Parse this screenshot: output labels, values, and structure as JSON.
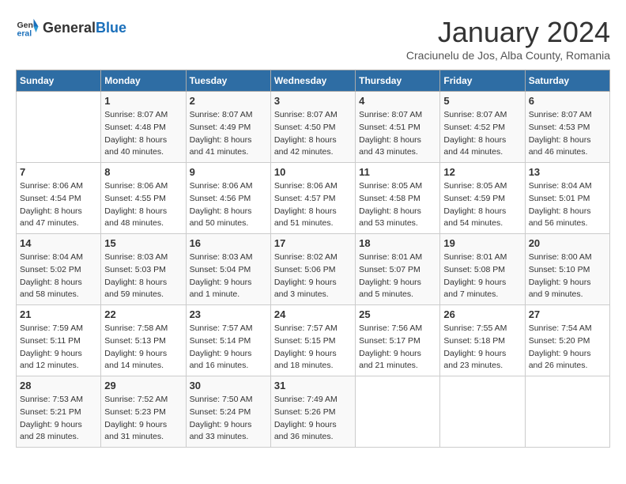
{
  "header": {
    "logo_general": "General",
    "logo_blue": "Blue",
    "month_title": "January 2024",
    "subtitle": "Craciunelu de Jos, Alba County, Romania"
  },
  "days_of_week": [
    "Sunday",
    "Monday",
    "Tuesday",
    "Wednesday",
    "Thursday",
    "Friday",
    "Saturday"
  ],
  "weeks": [
    [
      {
        "day": "",
        "info": ""
      },
      {
        "day": "1",
        "info": "Sunrise: 8:07 AM\nSunset: 4:48 PM\nDaylight: 8 hours\nand 40 minutes."
      },
      {
        "day": "2",
        "info": "Sunrise: 8:07 AM\nSunset: 4:49 PM\nDaylight: 8 hours\nand 41 minutes."
      },
      {
        "day": "3",
        "info": "Sunrise: 8:07 AM\nSunset: 4:50 PM\nDaylight: 8 hours\nand 42 minutes."
      },
      {
        "day": "4",
        "info": "Sunrise: 8:07 AM\nSunset: 4:51 PM\nDaylight: 8 hours\nand 43 minutes."
      },
      {
        "day": "5",
        "info": "Sunrise: 8:07 AM\nSunset: 4:52 PM\nDaylight: 8 hours\nand 44 minutes."
      },
      {
        "day": "6",
        "info": "Sunrise: 8:07 AM\nSunset: 4:53 PM\nDaylight: 8 hours\nand 46 minutes."
      }
    ],
    [
      {
        "day": "7",
        "info": "Sunrise: 8:06 AM\nSunset: 4:54 PM\nDaylight: 8 hours\nand 47 minutes."
      },
      {
        "day": "8",
        "info": "Sunrise: 8:06 AM\nSunset: 4:55 PM\nDaylight: 8 hours\nand 48 minutes."
      },
      {
        "day": "9",
        "info": "Sunrise: 8:06 AM\nSunset: 4:56 PM\nDaylight: 8 hours\nand 50 minutes."
      },
      {
        "day": "10",
        "info": "Sunrise: 8:06 AM\nSunset: 4:57 PM\nDaylight: 8 hours\nand 51 minutes."
      },
      {
        "day": "11",
        "info": "Sunrise: 8:05 AM\nSunset: 4:58 PM\nDaylight: 8 hours\nand 53 minutes."
      },
      {
        "day": "12",
        "info": "Sunrise: 8:05 AM\nSunset: 4:59 PM\nDaylight: 8 hours\nand 54 minutes."
      },
      {
        "day": "13",
        "info": "Sunrise: 8:04 AM\nSunset: 5:01 PM\nDaylight: 8 hours\nand 56 minutes."
      }
    ],
    [
      {
        "day": "14",
        "info": "Sunrise: 8:04 AM\nSunset: 5:02 PM\nDaylight: 8 hours\nand 58 minutes."
      },
      {
        "day": "15",
        "info": "Sunrise: 8:03 AM\nSunset: 5:03 PM\nDaylight: 8 hours\nand 59 minutes."
      },
      {
        "day": "16",
        "info": "Sunrise: 8:03 AM\nSunset: 5:04 PM\nDaylight: 9 hours\nand 1 minute."
      },
      {
        "day": "17",
        "info": "Sunrise: 8:02 AM\nSunset: 5:06 PM\nDaylight: 9 hours\nand 3 minutes."
      },
      {
        "day": "18",
        "info": "Sunrise: 8:01 AM\nSunset: 5:07 PM\nDaylight: 9 hours\nand 5 minutes."
      },
      {
        "day": "19",
        "info": "Sunrise: 8:01 AM\nSunset: 5:08 PM\nDaylight: 9 hours\nand 7 minutes."
      },
      {
        "day": "20",
        "info": "Sunrise: 8:00 AM\nSunset: 5:10 PM\nDaylight: 9 hours\nand 9 minutes."
      }
    ],
    [
      {
        "day": "21",
        "info": "Sunrise: 7:59 AM\nSunset: 5:11 PM\nDaylight: 9 hours\nand 12 minutes."
      },
      {
        "day": "22",
        "info": "Sunrise: 7:58 AM\nSunset: 5:13 PM\nDaylight: 9 hours\nand 14 minutes."
      },
      {
        "day": "23",
        "info": "Sunrise: 7:57 AM\nSunset: 5:14 PM\nDaylight: 9 hours\nand 16 minutes."
      },
      {
        "day": "24",
        "info": "Sunrise: 7:57 AM\nSunset: 5:15 PM\nDaylight: 9 hours\nand 18 minutes."
      },
      {
        "day": "25",
        "info": "Sunrise: 7:56 AM\nSunset: 5:17 PM\nDaylight: 9 hours\nand 21 minutes."
      },
      {
        "day": "26",
        "info": "Sunrise: 7:55 AM\nSunset: 5:18 PM\nDaylight: 9 hours\nand 23 minutes."
      },
      {
        "day": "27",
        "info": "Sunrise: 7:54 AM\nSunset: 5:20 PM\nDaylight: 9 hours\nand 26 minutes."
      }
    ],
    [
      {
        "day": "28",
        "info": "Sunrise: 7:53 AM\nSunset: 5:21 PM\nDaylight: 9 hours\nand 28 minutes."
      },
      {
        "day": "29",
        "info": "Sunrise: 7:52 AM\nSunset: 5:23 PM\nDaylight: 9 hours\nand 31 minutes."
      },
      {
        "day": "30",
        "info": "Sunrise: 7:50 AM\nSunset: 5:24 PM\nDaylight: 9 hours\nand 33 minutes."
      },
      {
        "day": "31",
        "info": "Sunrise: 7:49 AM\nSunset: 5:26 PM\nDaylight: 9 hours\nand 36 minutes."
      },
      {
        "day": "",
        "info": ""
      },
      {
        "day": "",
        "info": ""
      },
      {
        "day": "",
        "info": ""
      }
    ]
  ]
}
